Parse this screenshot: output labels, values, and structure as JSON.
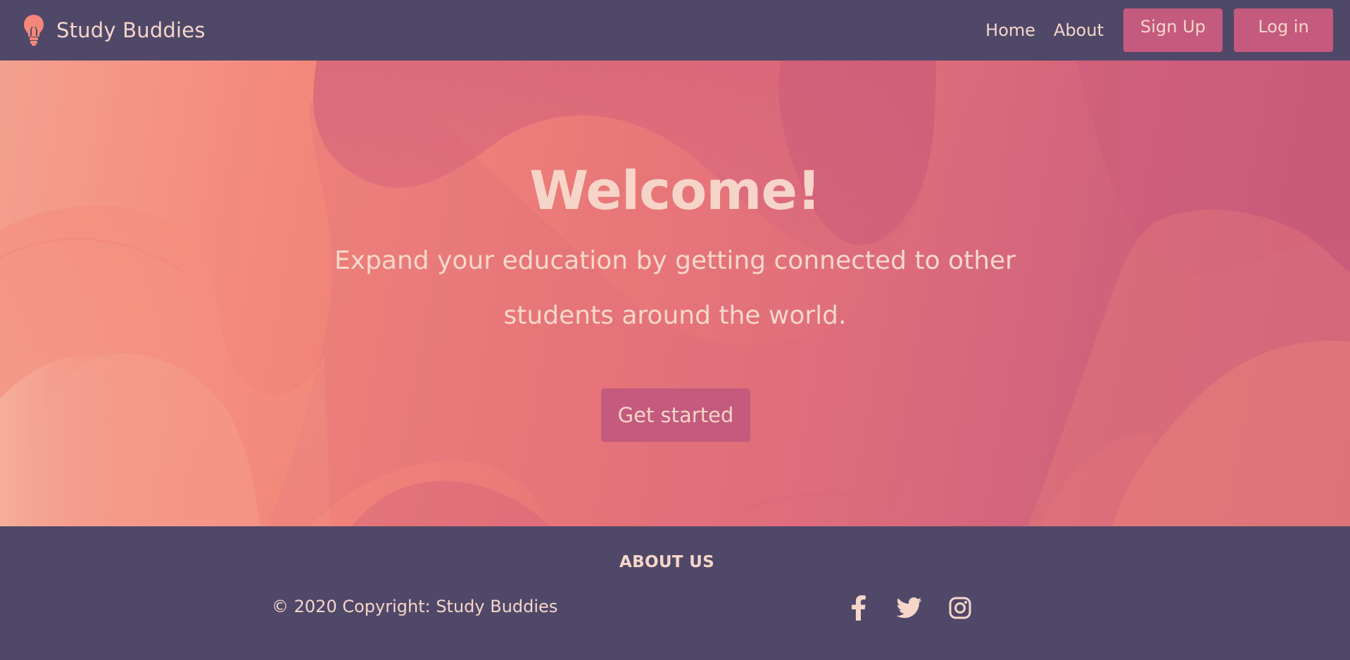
{
  "navbar": {
    "brand": "Study Buddies",
    "brand_icon": "lightbulb-icon",
    "links": {
      "home": "Home",
      "about": "About"
    },
    "buttons": {
      "signup": "Sign Up",
      "login": "Log in"
    }
  },
  "hero": {
    "title": "Welcome!",
    "subtitle": "Expand your education by getting connected to other students around the world.",
    "cta": "Get started"
  },
  "footer": {
    "heading": "ABOUT US",
    "copyright": "© 2020 Copyright: Study Buddies",
    "social": [
      "facebook-icon",
      "twitter-icon",
      "instagram-icon"
    ]
  },
  "colors": {
    "navbar_bg": "#4f4868",
    "accent": "#c45a7d",
    "text_light": "#f6d6c9",
    "hero_coral": "#f3877a",
    "hero_magenta": "#c85a7b"
  }
}
